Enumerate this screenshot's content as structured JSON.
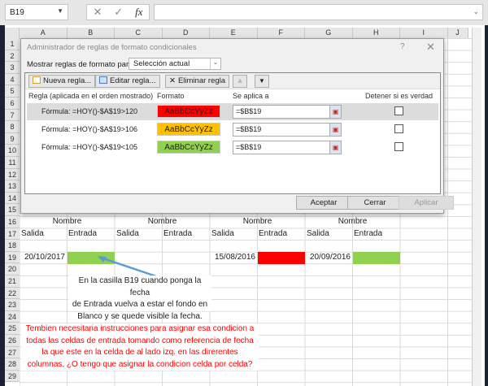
{
  "formula_bar": {
    "name_box": "B19",
    "cancel_icon": "✕",
    "enter_icon": "✓",
    "fx_label": "fx",
    "formula": ""
  },
  "columns": [
    "A",
    "B",
    "C",
    "D",
    "E",
    "F",
    "G",
    "H",
    "I",
    "J"
  ],
  "rows": [
    "1",
    "2",
    "3",
    "4",
    "5",
    "6",
    "7",
    "8",
    "9",
    "10",
    "11",
    "12",
    "13",
    "14",
    "15",
    "16",
    "17",
    "18",
    "19",
    "20",
    "21",
    "22",
    "23",
    "24",
    "25",
    "26",
    "27",
    "28",
    "29"
  ],
  "dialog": {
    "title": "Administrador de reglas de formato condicionales",
    "help": "?",
    "close": "✕",
    "show_rules_label": "Mostrar reglas de formato para:",
    "show_rules_value": "Selección actual",
    "toolbar": {
      "new_rule": "Nueva regla...",
      "edit_rule": "Editar regla...",
      "delete_rule": "Eliminar regla"
    },
    "headers": {
      "rule": "Regla (aplicada en el orden mostrado)",
      "format": "Formato",
      "applies_to": "Se aplica a",
      "stop_if_true": "Detener si es verdad"
    },
    "rules": [
      {
        "formula": "Fórmula: =HOY()-$A$19>120",
        "preview": "AaBbCcYyZz",
        "color": "#ff0000",
        "applies_to": "=$B$19",
        "stop": false
      },
      {
        "formula": "Fórmula: =HOY()-$A$19>106",
        "preview": "AaBbCcYyZz",
        "color": "#ffc000",
        "applies_to": "=$B$19",
        "stop": false
      },
      {
        "formula": "Fórmula: =HOY()-$A$19<105",
        "preview": "AaBbCcYyZz",
        "color": "#92d050",
        "applies_to": "=$B$19",
        "stop": false
      }
    ],
    "buttons": {
      "ok": "Aceptar",
      "close": "Cerrar",
      "apply": "Aplicar"
    }
  },
  "sheet": {
    "row16": [
      "Nombre",
      "Nombre",
      "Nombre",
      "Nombre"
    ],
    "row17": [
      "Salida",
      "Entrada",
      "Salida",
      "Entrada",
      "Salida",
      "Entrada",
      "Salida",
      "Entrada"
    ],
    "row19": {
      "A": "20/10/2017",
      "E": "15/08/2016",
      "G": "20/09/2016"
    },
    "fill_colors": {
      "B19": "#92d050",
      "F19": "#ff0000",
      "H19": "#92d050"
    },
    "note_lines": [
      "En la casilla B19 cuando ponga la fecha",
      "de Entrada vuelva a estar el fondo en",
      "Blanco y se quede visible la fecha."
    ],
    "question_lines": [
      "Tembien necesitaria instrucciones para asignar esa condicion a",
      "todas las celdas de entrada tomando como referencia de fecha",
      "la que este en la celda de al lado izq. en las direrentes",
      "columnas, ¿O tengo que asignar la condicion celda por celda?"
    ],
    "question_color": "#ff0000"
  }
}
